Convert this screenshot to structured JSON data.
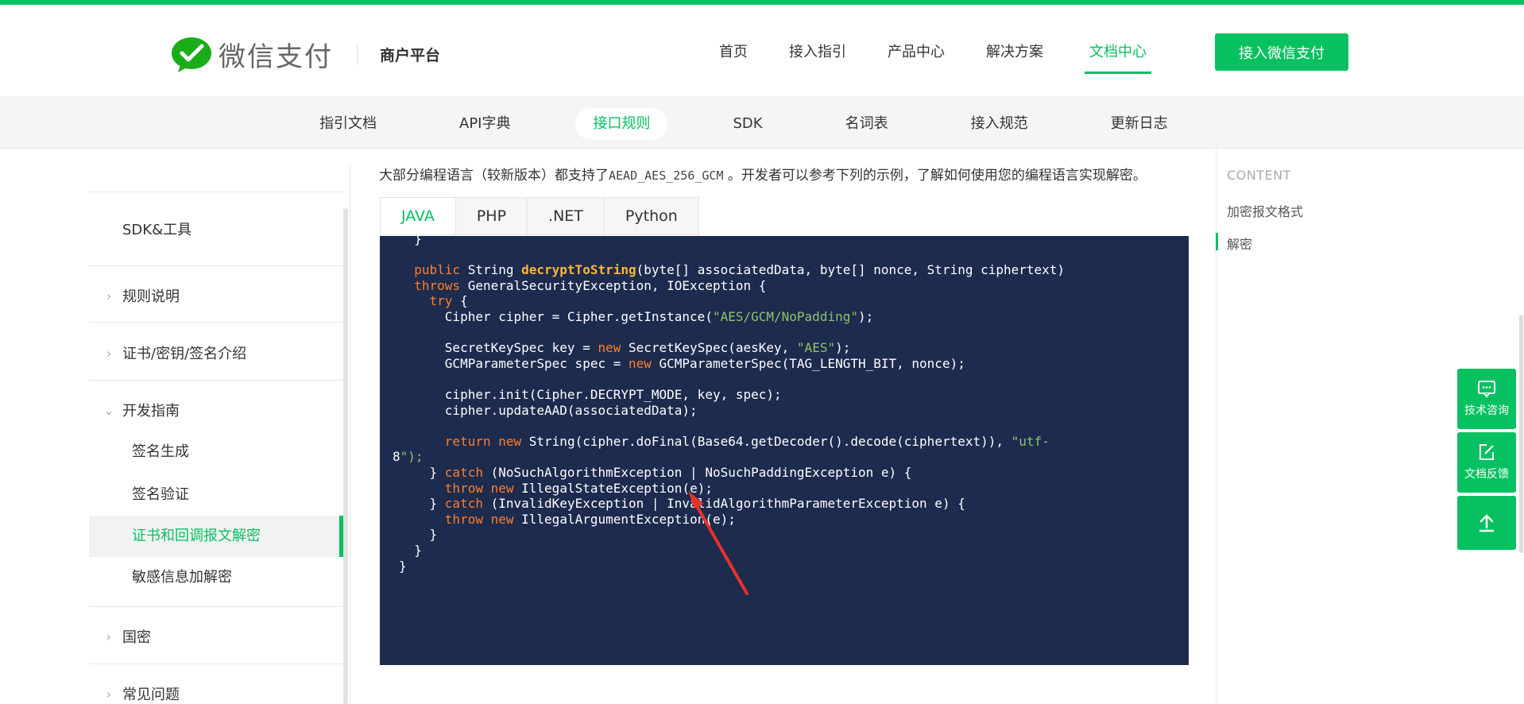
{
  "header": {
    "logo_text": "微信支付",
    "logo_sub": "商户平台",
    "nav": [
      "首页",
      "接入指引",
      "产品中心",
      "解决方案",
      "文档中心"
    ],
    "cta": "接入微信支付"
  },
  "subnav": [
    "指引文档",
    "API字典",
    "接口规则",
    "SDK",
    "名词表",
    "接入规范",
    "更新日志"
  ],
  "sidebar": {
    "top_items": [
      "SDK&工具",
      "规则说明",
      "证书/密钥/签名介绍",
      "开发指南"
    ],
    "children": [
      "签名生成",
      "签名验证",
      "证书和回调报文解密",
      "敏感信息加解密"
    ],
    "bottom_items": [
      "国密",
      "常见问题"
    ]
  },
  "intro": {
    "before": "大部分编程语言（较新版本）都支持了",
    "code": "AEAD_AES_256_GCM",
    "after": " 。开发者可以参考下列的示例，了解如何使用您的编程语言实现解密。"
  },
  "tabs": [
    "JAVA",
    "PHP",
    ".NET",
    "Python"
  ],
  "code_lines": [
    "  }",
    "",
    "  public String decryptToString(byte[] associatedData, byte[] nonce, String ciphertext)",
    "  throws GeneralSecurityException, IOException {",
    "    try {",
    "      Cipher cipher = Cipher.getInstance(\"AES/GCM/NoPadding\");",
    "",
    "      SecretKeySpec key = new SecretKeySpec(aesKey, \"AES\");",
    "      GCMParameterSpec spec = new GCMParameterSpec(TAG_LENGTH_BIT, nonce);",
    "",
    "      cipher.init(Cipher.DECRYPT_MODE, key, spec);",
    "      cipher.updateAAD(associatedData);",
    "",
    "      return new String(cipher.doFinal(Base64.getDecoder().decode(ciphertext)), \"utf-",
    "8\");",
    "    } catch (NoSuchAlgorithmException | NoSuchPaddingException e) {",
    "      throw new IllegalStateException(e);",
    "    } catch (InvalidKeyException | InvalidAlgorithmParameterException e) {",
    "      throw new IllegalArgumentException(e);",
    "    }",
    "  }",
    "}"
  ],
  "toc": {
    "title": "CONTENT",
    "items": [
      "加密报文格式",
      "解密"
    ]
  },
  "float_buttons": [
    "技术咨询",
    "文档反馈"
  ],
  "colors": {
    "brand": "#07c160",
    "code_bg": "#1c2b4e",
    "keyword": "#ff7f2a",
    "type": "#b7a7ff",
    "method": "#ffb43c",
    "string": "#8fc46b",
    "arrow": "#e8322c"
  }
}
